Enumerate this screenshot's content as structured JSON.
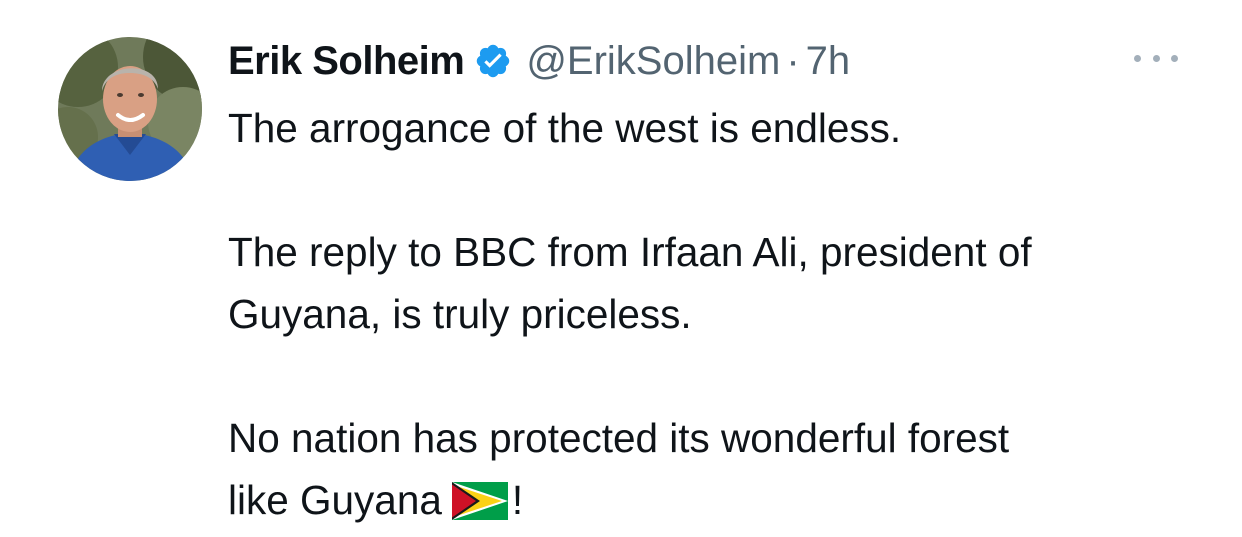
{
  "tweet": {
    "author_name": "Erik Solheim",
    "handle": "@ErikSolheim",
    "separator": "·",
    "time": "7h",
    "verified_icon": "verified-badge-icon",
    "more_icon": "more-options-icon",
    "paragraphs": {
      "p1": "The arrogance of the west is endless.",
      "p2_line1": "The reply to BBC from Irfaan Ali, president of",
      "p2_line2": "Guyana, is truly priceless.",
      "p3_line1": "No nation has protected its wonderful forest",
      "p3_line2_text": "like Guyana",
      "p3_line2_end": "!"
    },
    "flag_icon": "guyana-flag-icon"
  },
  "colors": {
    "text": "#0f1419",
    "secondary": "#536471",
    "verified_blue": "#1d9bf0",
    "flag_green": "#009e49",
    "flag_yellow": "#fcd116",
    "flag_red": "#ce1126"
  }
}
